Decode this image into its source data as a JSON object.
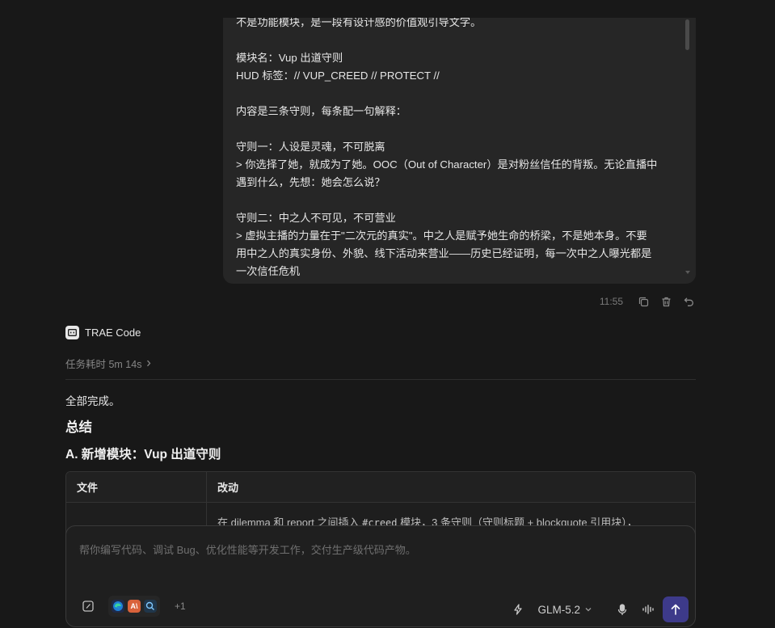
{
  "message": {
    "lines": [
      "不是功能模块，是一段有设计感的价值观引导文字。",
      "",
      "模块名：Vup 出道守则",
      "HUD 标签：// VUP_CREED // PROTECT //",
      "",
      "内容是三条守则，每条配一句解释：",
      "",
      "守则一：人设是灵魂，不可脱离",
      "> 你选择了她，就成为了她。OOC（Out of Character）是对粉丝信任的背叛。无论直播中",
      "遇到什么，先想：她会怎么说？",
      "",
      "守则二：中之人不可见，不可营业",
      "> 虚拟主播的力量在于\"二次元的真实\"。中之人是赋予她生命的桥梁，不是她本身。不要",
      "用中之人的真实身份、外貌、线下活动来营业——历史已经证明，每一次中之人曝光都是",
      "一次信任危机"
    ],
    "time": "11:55"
  },
  "agent": {
    "name": "TRAE Code",
    "task_time": "任务耗时 5m 14s"
  },
  "content": {
    "done": "全部完成。",
    "summary_heading": "总结",
    "section_a": "A. 新增模块：Vup 出道守则",
    "table": {
      "headers": [
        "文件",
        "改动"
      ],
      "row1_text_before": "在 dilemma 和 report 之间插入 ",
      "row1_code": "#creed",
      "row1_text_after": " 模块，3 条守则（守则标题 + blockquote 引用块），"
    }
  },
  "composer": {
    "placeholder": "帮你编写代码、调试 Bug、优化性能等开发工作，交付生产级代码产物。",
    "context_more": "+1",
    "model": "GLM-5.2",
    "context_chips": [
      "A\\"
    ]
  },
  "colors": {
    "accent_send": "#3d3a8a",
    "background": "#181818",
    "bubble": "#262626"
  }
}
